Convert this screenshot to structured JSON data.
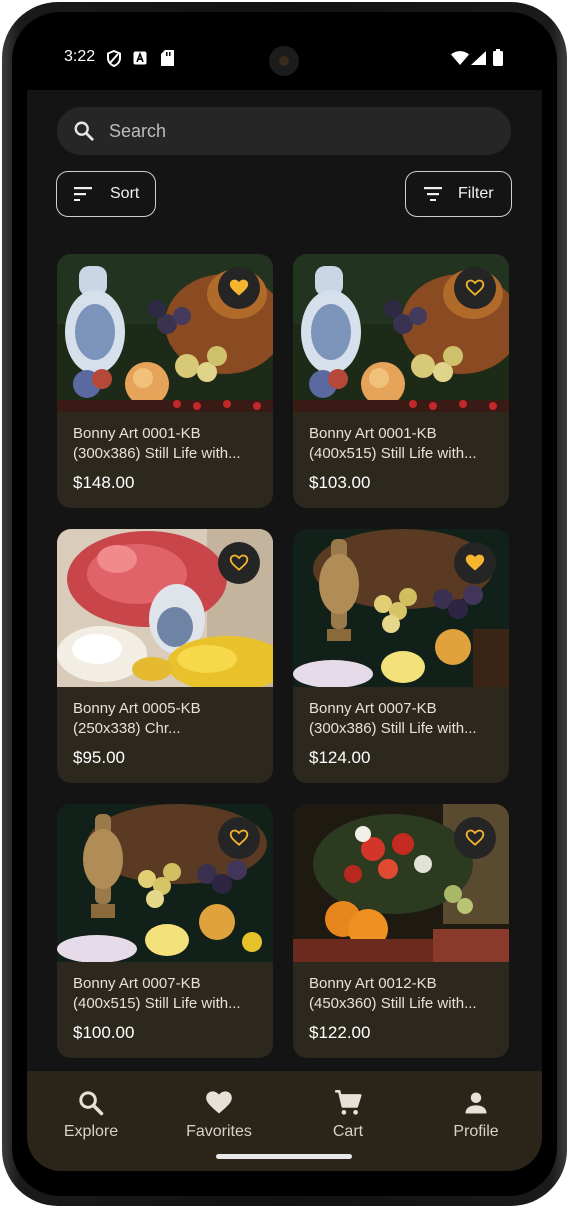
{
  "status_bar": {
    "time": "3:22"
  },
  "search": {
    "placeholder": "Search"
  },
  "toolbar": {
    "sort_label": "Sort",
    "filter_label": "Filter"
  },
  "products": [
    {
      "title": "Bonny Art 0001-KB (300x386) Still Life with...",
      "price": "$148.00",
      "favorited": true
    },
    {
      "title": "Bonny Art 0001-KB (400x515) Still Life with...",
      "price": "$103.00",
      "favorited": false
    },
    {
      "title": "Bonny Art 0005-KB (250x338) Chr...",
      "price": "$95.00",
      "favorited": false
    },
    {
      "title": "Bonny Art 0007-KB (300x386) Still Life with...",
      "price": "$124.00",
      "favorited": true
    },
    {
      "title": "Bonny Art 0007-KB (400x515) Still Life with...",
      "price": "$100.00",
      "favorited": false
    },
    {
      "title": "Bonny Art 0012-KB (450x360) Still Life with...",
      "price": "$122.00",
      "favorited": false
    }
  ],
  "bottom_nav": [
    {
      "label": "Explore",
      "icon": "search-icon"
    },
    {
      "label": "Favorites",
      "icon": "heart-icon"
    },
    {
      "label": "Cart",
      "icon": "cart-icon"
    },
    {
      "label": "Profile",
      "icon": "person-icon"
    }
  ],
  "colors": {
    "accent": "#f5b52e",
    "card": "#2c281d",
    "nav": "#2b2519",
    "background": "#141414"
  }
}
